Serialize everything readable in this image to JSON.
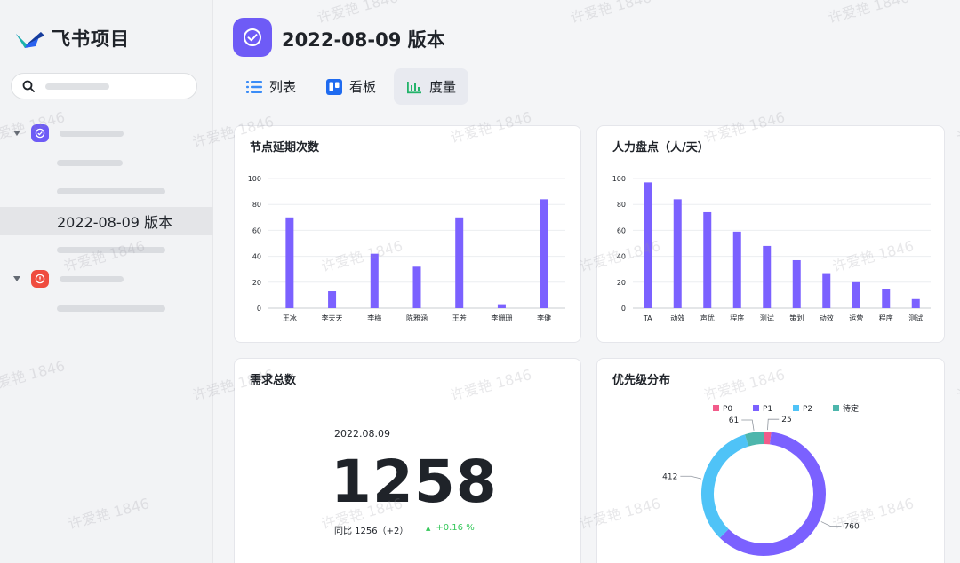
{
  "app": {
    "name": "飞书项目"
  },
  "sidebar": {
    "selected_item": "2022-08-09 版本"
  },
  "page": {
    "title": "2022-08-09 版本"
  },
  "tabs": [
    {
      "label": "列表",
      "icon": "list-icon"
    },
    {
      "label": "看板",
      "icon": "kanban-icon"
    },
    {
      "label": "度量",
      "icon": "bar-chart-icon",
      "active": true
    }
  ],
  "cards": {
    "delay": {
      "title": "节点延期次数"
    },
    "manpower": {
      "title": "人力盘点（人/天）"
    },
    "total": {
      "title": "需求总数",
      "date": "2022.08.09",
      "value": "1258",
      "compare": "同比 1256（+2）",
      "delta": "+0.16 %"
    },
    "priority": {
      "title": "优先级分布"
    }
  },
  "watermark": "许爱艳 1846",
  "colors": {
    "accent": "#6e5bf6",
    "bar": "#7b61ff"
  },
  "chart_data": [
    {
      "type": "bar",
      "title": "节点延期次数",
      "categories": [
        "王冰",
        "李天天",
        "李梅",
        "陈雅涵",
        "王芳",
        "李姗珊",
        "李健"
      ],
      "values": [
        70,
        13,
        42,
        32,
        70,
        3,
        84
      ],
      "ylim": [
        0,
        100
      ],
      "yticks": [
        0,
        20,
        40,
        60,
        80,
        100
      ],
      "grid": true
    },
    {
      "type": "bar",
      "title": "人力盘点（人/天）",
      "categories": [
        "TA",
        "动效",
        "声优",
        "程序",
        "测试",
        "策划",
        "动效",
        "运营",
        "程序",
        "测试"
      ],
      "values": [
        97,
        84,
        74,
        59,
        48,
        37,
        27,
        20,
        15,
        7
      ],
      "ylim": [
        0,
        100
      ],
      "yticks": [
        0,
        20,
        40,
        60,
        80,
        100
      ],
      "grid": true
    },
    {
      "type": "pie",
      "title": "优先级分布",
      "legend": [
        "P0",
        "P1",
        "P2",
        "待定"
      ],
      "values": [
        25,
        760,
        412,
        61
      ],
      "colors": [
        "#f25b8a",
        "#7b61ff",
        "#4fc3f7",
        "#4db6ac"
      ],
      "labels": [
        "25",
        "760",
        "412",
        "61"
      ],
      "legend_position": "top"
    }
  ]
}
